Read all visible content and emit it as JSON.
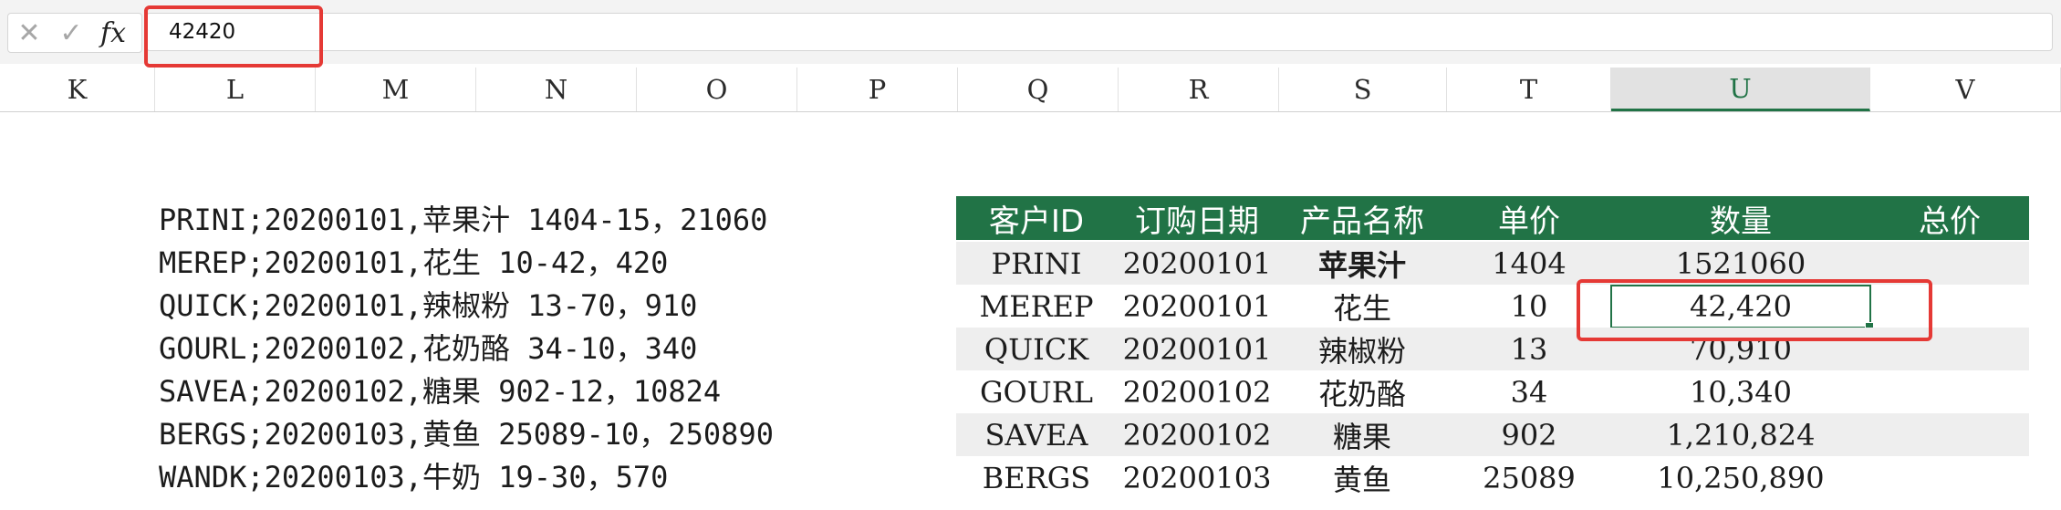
{
  "formula_bar": {
    "cancel_glyph": "✕",
    "confirm_glyph": "✓",
    "fx_label": "fx",
    "value": "42420"
  },
  "columns": [
    "K",
    "L",
    "M",
    "N",
    "O",
    "P",
    "Q",
    "R",
    "S",
    "T",
    "U",
    "V"
  ],
  "selected_column": "U",
  "text_lines": [
    "PRINI;20200101,苹果汁 1404-15，21060",
    "MEREP;20200101,花生 10-42，420",
    "QUICK;20200101,辣椒粉 13-70，910",
    "GOURL;20200102,花奶酪 34-10，340",
    "SAVEA;20200102,糖果 902-12，10824",
    "BERGS;20200103,黄鱼 25089-10，250890",
    "WANDK;20200103,牛奶 19-30，570"
  ],
  "table": {
    "headers": [
      "客户ID",
      "订购日期",
      "产品名称",
      "单价",
      "数量",
      "总价"
    ],
    "rows": [
      [
        "PRINI",
        "20200101",
        "苹果汁",
        "1404",
        "1521060",
        ""
      ],
      [
        "MEREP",
        "20200101",
        "花生",
        "10",
        "42,420",
        ""
      ],
      [
        "QUICK",
        "20200101",
        "辣椒粉",
        "13",
        "70,910",
        ""
      ],
      [
        "GOURL",
        "20200102",
        "花奶酪",
        "34",
        "10,340",
        ""
      ],
      [
        "SAVEA",
        "20200102",
        "糖果",
        "902",
        "1,210,824",
        ""
      ],
      [
        "BERGS",
        "20200103",
        "黄鱼",
        "25089",
        "10,250,890",
        ""
      ]
    ]
  },
  "colors": {
    "header_green": "#217346",
    "annotation_red": "#e53935",
    "row_alt": "#eeeeee"
  }
}
